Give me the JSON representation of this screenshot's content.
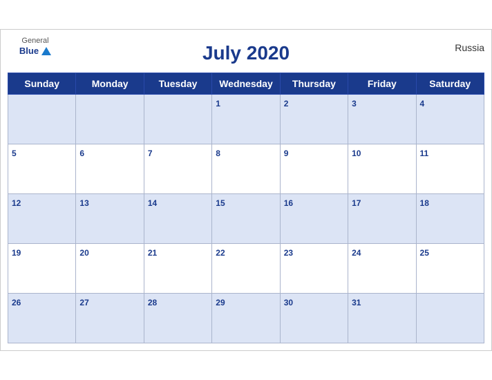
{
  "calendar": {
    "title": "July 2020",
    "country": "Russia",
    "logo": {
      "general": "General",
      "blue": "Blue"
    },
    "days_of_week": [
      "Sunday",
      "Monday",
      "Tuesday",
      "Wednesday",
      "Thursday",
      "Friday",
      "Saturday"
    ],
    "weeks": [
      [
        null,
        null,
        null,
        1,
        2,
        3,
        4
      ],
      [
        5,
        6,
        7,
        8,
        9,
        10,
        11
      ],
      [
        12,
        13,
        14,
        15,
        16,
        17,
        18
      ],
      [
        19,
        20,
        21,
        22,
        23,
        24,
        25
      ],
      [
        26,
        27,
        28,
        29,
        30,
        31,
        null
      ]
    ]
  }
}
